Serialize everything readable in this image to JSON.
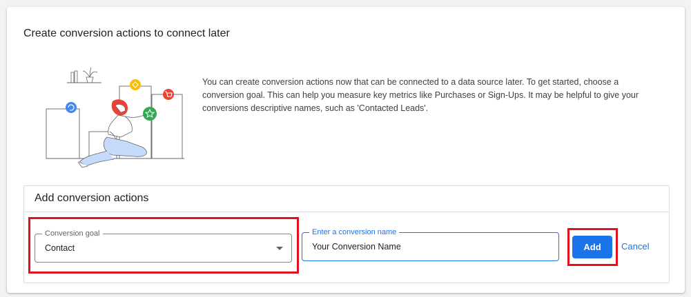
{
  "header": {
    "title": "Create conversion actions to connect later"
  },
  "intro": {
    "description": "You can create conversion actions now that can be connected to a data source later. To get started, choose a conversion goal. This can help you measure key metrics like Purchases or Sign-Ups. It may be helpful to give your conversions descriptive names, such as 'Contacted Leads'."
  },
  "add_panel": {
    "title": "Add conversion actions",
    "goal_field": {
      "label": "Conversion goal",
      "value": "Contact"
    },
    "name_field": {
      "label": "Enter a conversion name",
      "value": "Your Conversion Name"
    },
    "add_label": "Add",
    "cancel_label": "Cancel"
  },
  "colors": {
    "accent": "#1a73e8",
    "highlight": "#e0101c",
    "illustration_red": "#ea4335",
    "illustration_yellow": "#fbbc04",
    "illustration_green": "#34a853",
    "illustration_blue": "#4285f4"
  },
  "illustration_icons": [
    "refresh-icon",
    "tag-icon",
    "cart-icon",
    "star-icon"
  ]
}
